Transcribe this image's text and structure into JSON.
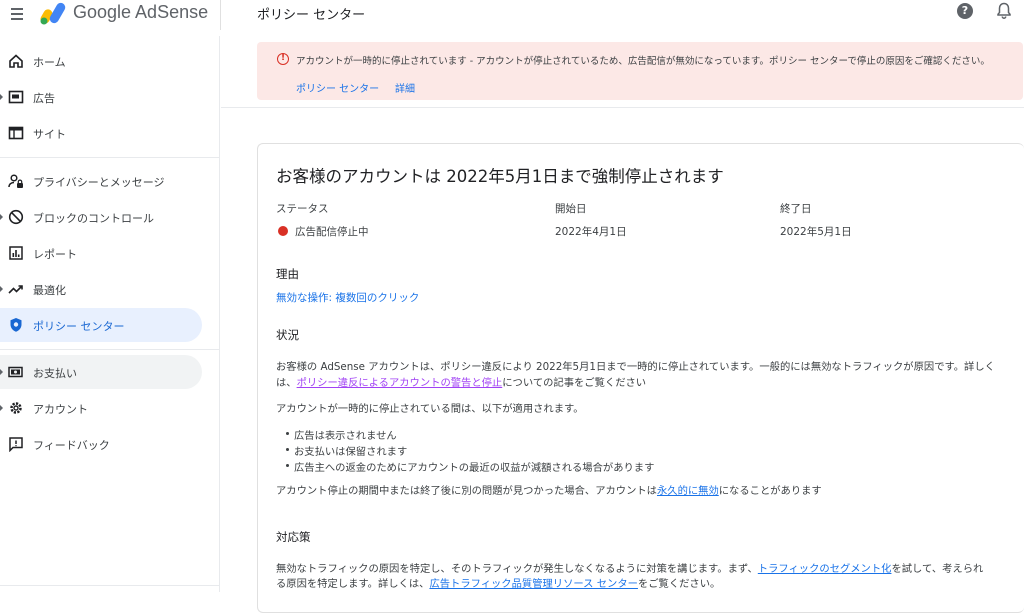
{
  "app": {
    "brand": "Google AdSense",
    "page_title": "ポリシー センター",
    "help_icon_glyph": "?"
  },
  "sidebar": {
    "items": [
      {
        "label": "ホーム",
        "icon": "home-icon"
      },
      {
        "label": "広告",
        "icon": "ads-icon"
      },
      {
        "label": "サイト",
        "icon": "sites-icon"
      },
      {
        "label": "プライバシーとメッセージ",
        "icon": "privacy-icon"
      },
      {
        "label": "ブロックのコントロール",
        "icon": "block-icon"
      },
      {
        "label": "レポート",
        "icon": "reports-icon"
      },
      {
        "label": "最適化",
        "icon": "optimization-icon"
      },
      {
        "label": "ポリシー センター",
        "icon": "policy-shield-icon",
        "active": true
      },
      {
        "label": "お支払い",
        "icon": "payments-icon"
      },
      {
        "label": "アカウント",
        "icon": "account-gear-icon"
      },
      {
        "label": "フィードバック",
        "icon": "feedback-icon"
      }
    ]
  },
  "alert": {
    "icon_glyph": "!",
    "text": "アカウントが一時的に停止されています - アカウントが停止されているため、広告配信が無効になっています。ポリシー センターで停止の原因をご確認ください。",
    "link_policy": "ポリシー センター",
    "link_details": "詳細"
  },
  "card": {
    "title": "お客様のアカウントは 2022年5月1日まで強制停止されます",
    "col_status": "ステータス",
    "col_start": "開始日",
    "col_end": "終了日",
    "status_value": "広告配信停止中",
    "start_value": "2022年4月1日",
    "end_value": "2022年5月1日",
    "status_color": "#d93025",
    "reason_head": "理由",
    "reason_link": "無効な操作: 複数回のクリック",
    "situation_head": "状況",
    "situation_p1_line1": "お客様の AdSense アカウントは、ポリシー違反により 2022年5月1日まで一時的に停止されています。一般的には無効なトラフィックが原因です。詳しく",
    "situation_p1_line2_pre": "は、",
    "situation_p1_link": "ポリシー違反によるアカウントの警告と停止",
    "situation_p1_line2_post": "についての記事をご覧ください",
    "situation_p2": "アカウントが一時的に停止されている間は、以下が適用されます。",
    "bullets": [
      "広告は表示されません",
      "お支払いは保留されます",
      "広告主への返金のためにアカウントの最近の収益が減額される場合があります"
    ],
    "situation_p3_pre": "アカウント停止の期間中または終了後に別の問題が見つかった場合、アカウントは",
    "situation_p3_link": "永久的に無効",
    "situation_p3_post": "になることがあります",
    "remedy_head": "対応策",
    "remedy_line1_pre": "無効なトラフィックの原因を特定し、そのトラフィックが発生しなくなるように対策を講じます。まず、",
    "remedy_link1": "トラフィックのセグメント化",
    "remedy_line1_post": "を試して、考えられ",
    "remedy_line2_pre": "る原因を特定します。詳しくは、",
    "remedy_link2": "広告トラフィック品質管理リソース センター",
    "remedy_line2_post": "をご覧ください。"
  }
}
